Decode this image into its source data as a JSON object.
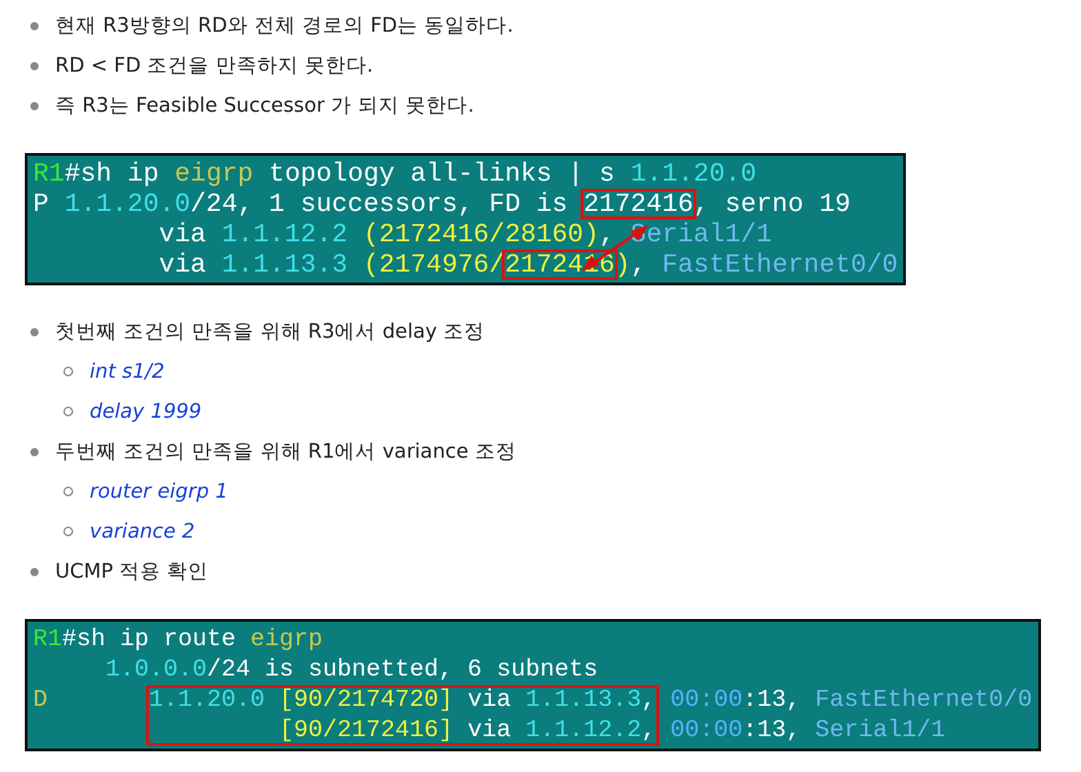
{
  "sections": [
    {
      "kind": "bullets",
      "items": [
        {
          "text": "현재 R3방향의 RD와 전체 경로의 FD는 동일하다."
        },
        {
          "text": "RD < FD 조건을 만족하지 못한다."
        },
        {
          "text": "즉 R3는 Feasible Successor 가 되지 못한다."
        }
      ]
    },
    {
      "kind": "terminal",
      "connector": true,
      "lines": [
        {
          "kind": "line",
          "segments": [
            {
              "text": "R1",
              "color": "#38e838",
              "boxed": false
            },
            {
              "text": "#sh ip ",
              "color": "#ffffff",
              "boxed": false
            },
            {
              "text": "eigrp",
              "color": "#c8c850",
              "boxed": false
            },
            {
              "text": " topology all-links | s ",
              "color": "#ffffff",
              "boxed": false
            },
            {
              "text": "1.1.20.0",
              "color": "#40e0e8",
              "boxed": false
            }
          ]
        },
        {
          "kind": "line",
          "segments": [
            {
              "text": "P ",
              "color": "#ffffff",
              "boxed": false
            },
            {
              "text": "1.1.20.0",
              "color": "#40e0e8",
              "boxed": false
            },
            {
              "text": "/24, 1 successors, FD is ",
              "color": "#ffffff",
              "boxed": false
            },
            {
              "text": "2172416",
              "color": "#ffffff",
              "boxed": true
            },
            {
              "text": ", serno 19",
              "color": "#ffffff",
              "boxed": false
            }
          ]
        },
        {
          "kind": "line",
          "segments": [
            {
              "text": "        via ",
              "color": "#ffffff",
              "boxed": false
            },
            {
              "text": "1.1.12.2",
              "color": "#40e0e8",
              "boxed": false
            },
            {
              "text": " (2172416/28160)",
              "color": "#f0f040",
              "boxed": false
            },
            {
              "text": ", ",
              "color": "#ffffff",
              "boxed": false
            },
            {
              "text": "Serial1/1",
              "color": "#70b8f0",
              "boxed": false
            }
          ]
        },
        {
          "kind": "line",
          "segments": [
            {
              "text": "        via ",
              "color": "#ffffff",
              "boxed": false
            },
            {
              "text": "1.1.13.3",
              "color": "#40e0e8",
              "boxed": false
            },
            {
              "text": " (2174976/",
              "color": "#f0f040",
              "boxed": false
            },
            {
              "text": "2172416",
              "color": "#f0f040",
              "boxed": true
            },
            {
              "text": ")",
              "color": "#f0f040",
              "boxed": false
            },
            {
              "text": ", ",
              "color": "#ffffff",
              "boxed": false
            },
            {
              "text": "FastEthernet0/0",
              "color": "#70b8f0",
              "boxed": false
            }
          ]
        }
      ]
    },
    {
      "kind": "bullets",
      "items": [
        {
          "text": "첫번째 조건의 만족을 위해 R3에서 delay 조정",
          "children": [
            {
              "text": "int s1/2"
            },
            {
              "text": "delay 1999"
            }
          ]
        },
        {
          "text": "두번째 조건의 만족을 위해 R1에서 variance 조정",
          "children": [
            {
              "text": "router eigrp 1"
            },
            {
              "text": "variance 2"
            }
          ]
        },
        {
          "text": "UCMP 적용 확인"
        }
      ]
    },
    {
      "kind": "terminal",
      "connector": false,
      "lines": [
        {
          "kind": "line",
          "segments": [
            {
              "text": "R1",
              "color": "#38e838",
              "boxed": false
            },
            {
              "text": "#sh ip route ",
              "color": "#ffffff",
              "boxed": false
            },
            {
              "text": "eigrp",
              "color": "#c8c850",
              "boxed": false
            }
          ]
        },
        {
          "kind": "line",
          "segments": [
            {
              "text": "     1.0.0.0",
              "color": "#40e0e8",
              "boxed": false
            },
            {
              "text": "/24 is subnetted, 6 subnets",
              "color": "#ffffff",
              "boxed": false
            }
          ]
        },
        {
          "kind": "boxed_group",
          "rows": [
            {
              "lead": [
                {
                  "text": "D       ",
                  "color": "#c8c850"
                }
              ],
              "boxed": [
                {
                  "text": "1.1.20.0 ",
                  "color": "#40e0e8"
                },
                {
                  "text": "[90/2174720]",
                  "color": "#f0f040"
                },
                {
                  "text": " via ",
                  "color": "#ffffff"
                },
                {
                  "text": "1.1.13.3",
                  "color": "#40e0e8"
                },
                {
                  "text": ",",
                  "color": "#ffffff"
                }
              ],
              "tail": [
                {
                  "text": " 00:00",
                  "color": "#58b0ff"
                },
                {
                  "text": ":13, ",
                  "color": "#ffffff"
                },
                {
                  "text": "FastEthernet0/0",
                  "color": "#70b8f0"
                }
              ]
            },
            {
              "boxed": [
                {
                  "text": "         [90/2172416]",
                  "color": "#f0f040"
                },
                {
                  "text": " via ",
                  "color": "#ffffff"
                },
                {
                  "text": "1.1.12.2",
                  "color": "#40e0e8"
                },
                {
                  "text": ",",
                  "color": "#ffffff"
                }
              ],
              "tail": [
                {
                  "text": " 00:00",
                  "color": "#58b0ff"
                },
                {
                  "text": ":13, ",
                  "color": "#ffffff"
                },
                {
                  "text": "Serial1/1",
                  "color": "#70b8f0"
                }
              ]
            }
          ]
        }
      ]
    }
  ]
}
